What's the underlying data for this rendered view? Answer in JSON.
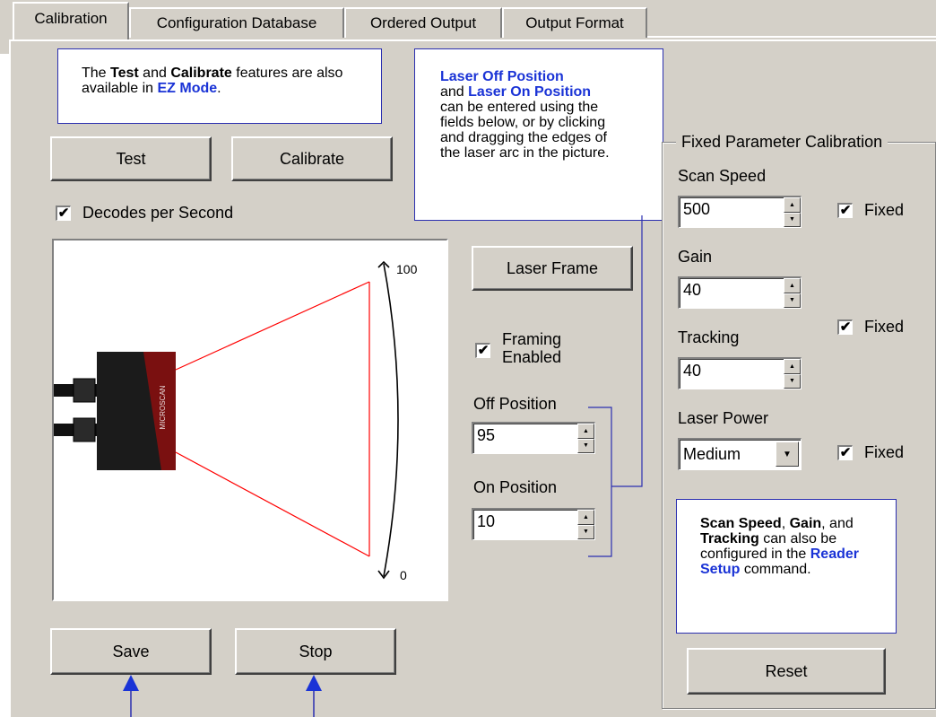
{
  "tabs": [
    {
      "label": "Calibration"
    },
    {
      "label": "Configuration Database"
    },
    {
      "label": "Ordered Output"
    },
    {
      "label": "Output Format"
    }
  ],
  "callout_test": {
    "p1": "The ",
    "b1": "Test",
    "p2": " and ",
    "b2": "Calibrate",
    "p3": " features are also available in ",
    "link": "EZ Mode",
    "p4": "."
  },
  "callout_laser": {
    "link1": "Laser Off Position",
    "p1": "and ",
    "link2": "Laser On Position",
    "p2": "can be entered using the fields below, or by clicking and dragging the edges of the laser arc in the picture."
  },
  "callout_speed": {
    "b1": "Scan Speed",
    "p1": ", ",
    "b2": "Gain",
    "p2": ", and ",
    "b3": "Tracking",
    "p3": " can also be configured in the ",
    "link": "Reader Setup",
    "p4": " command."
  },
  "buttons": {
    "test": "Test",
    "calibrate": "Calibrate",
    "laser_frame": "Laser Frame",
    "save": "Save",
    "stop": "Stop",
    "reset": "Reset"
  },
  "decodes": {
    "label": "Decodes per Second",
    "checked": true
  },
  "picture": {
    "label_top": "100",
    "label_bottom": "0",
    "device_text": "MICROSCAN"
  },
  "framing": {
    "line1": "Framing",
    "line2": "Enabled",
    "checked": true
  },
  "off_position": {
    "label": "Off Position",
    "value": "95"
  },
  "on_position": {
    "label": "On Position",
    "value": "10"
  },
  "fixed_group": {
    "title": "Fixed Parameter Calibration",
    "scan_speed": {
      "label": "Scan Speed",
      "value": "500",
      "fixed_label": "Fixed",
      "fixed": true
    },
    "gain": {
      "label": "Gain",
      "value": "40"
    },
    "tracking": {
      "label": "Tracking",
      "value": "40",
      "fixed_label": "Fixed",
      "fixed": true
    },
    "laser_power": {
      "label": "Laser Power",
      "value": "Medium",
      "fixed_label": "Fixed",
      "fixed": true
    }
  },
  "colors": {
    "accent_blue": "#1a33d6",
    "laser_red": "#ff0000",
    "face": "#d4d0c8"
  }
}
